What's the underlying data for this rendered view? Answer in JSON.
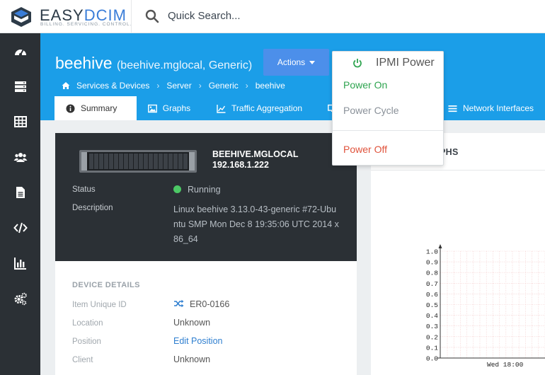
{
  "brand": {
    "name_part1": "EASY",
    "name_part2": "DCIM",
    "tagline": "BILLING. SERVICING. CONTROL."
  },
  "search": {
    "placeholder": "Quick Search..."
  },
  "sidebar": {
    "items": [
      {
        "icon": "dashboard-icon"
      },
      {
        "icon": "servers-icon"
      },
      {
        "icon": "table-icon"
      },
      {
        "icon": "users-icon"
      },
      {
        "icon": "document-icon"
      },
      {
        "icon": "code-icon"
      },
      {
        "icon": "bar-chart-icon"
      },
      {
        "icon": "gears-icon"
      }
    ]
  },
  "header": {
    "title": "beehive",
    "subtitle": "(beehive.mglocal, Generic)",
    "actions_label": "Actions",
    "breadcrumb": [
      "Services & Devices",
      "Server",
      "Generic",
      "beehive"
    ]
  },
  "tabs": [
    {
      "label": "Summary",
      "icon": "info-icon",
      "active": true
    },
    {
      "label": "Graphs",
      "icon": "image-icon",
      "active": false
    },
    {
      "label": "Traffic Aggregation",
      "icon": "area-chart-icon",
      "active": false
    },
    {
      "label": "Network Interfaces",
      "icon": "list-icon",
      "active": false
    }
  ],
  "device": {
    "hostname": "BEEHIVE.MGLOCAL",
    "ip": "192.168.1.222",
    "status_label": "Status",
    "status_value": "Running",
    "status_color": "#4cc865",
    "description_label": "Description",
    "description_value": "Linux beehive 3.13.0-43-generic #72-Ubuntu SMP Mon Dec 8 19:35:06 UTC 2014 x86_64"
  },
  "details": {
    "section_title": "DEVICE DETAILS",
    "rows": [
      {
        "label": "Item Unique ID",
        "value": "ER0-0166"
      },
      {
        "label": "Location",
        "value": "Unknown"
      },
      {
        "label": "Position",
        "value": "Edit Position"
      },
      {
        "label": "Client",
        "value": "Unknown"
      }
    ]
  },
  "graphs_panel": {
    "title_fragment": "PHS",
    "chart": {
      "y_ticks": [
        "1.0",
        "0.9",
        "0.8",
        "0.7",
        "0.6",
        "0.5",
        "0.4",
        "0.3",
        "0.2",
        "0.1",
        "0.0"
      ],
      "x_tick": "Wed 18:00"
    }
  },
  "dropdown": {
    "header": "IPMI Power",
    "items": [
      {
        "label": "Power On",
        "color": "#2ea44f"
      },
      {
        "label": "Power Cycle",
        "color": "#8a9199"
      },
      {
        "label": "Power Off",
        "color": "#e0533c"
      }
    ]
  }
}
